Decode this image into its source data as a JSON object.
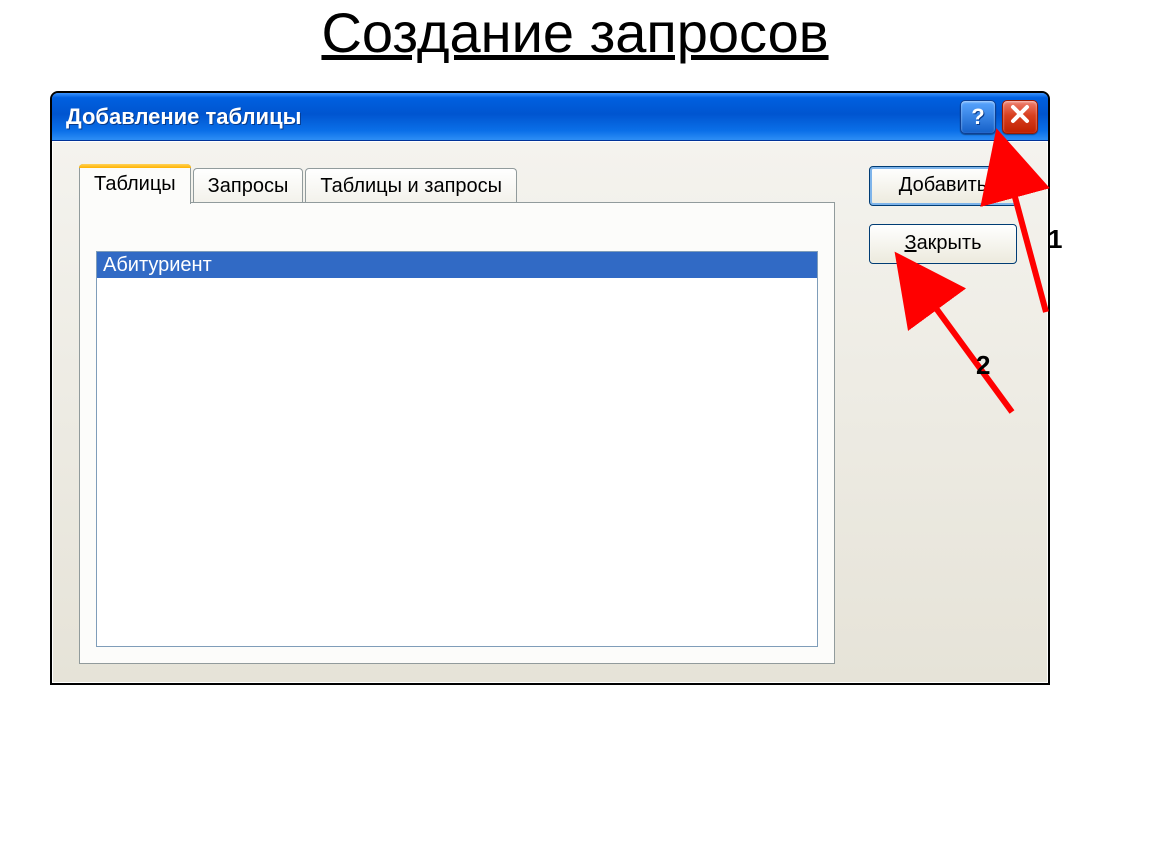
{
  "page": {
    "heading": "Создание запросов"
  },
  "window": {
    "title": "Добавление таблицы",
    "help": "?"
  },
  "tabs": [
    {
      "label": "Таблицы",
      "active": true
    },
    {
      "label": "Запросы",
      "active": false
    },
    {
      "label": "Таблицы и запросы",
      "active": false
    }
  ],
  "list": {
    "items": [
      "Абитуриент"
    ]
  },
  "buttons": {
    "add_mn": "Д",
    "add_rest": "обавить",
    "close_mn": "З",
    "close_rest": "акрыть"
  },
  "annotations": {
    "a1": "1",
    "a2": "2"
  }
}
